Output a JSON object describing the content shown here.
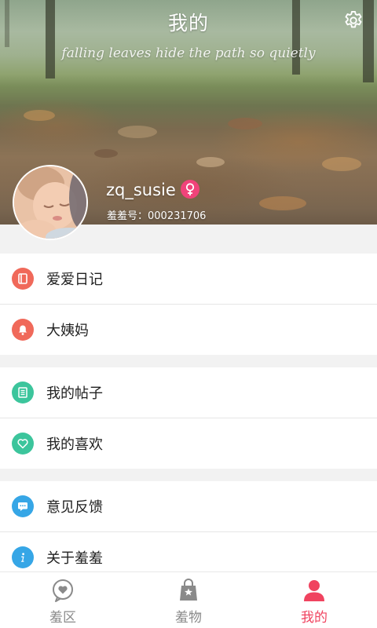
{
  "header": {
    "title": "我的",
    "subtitle": "falling leaves hide the path so quietly",
    "settings_icon": "gear-icon"
  },
  "profile": {
    "username": "zq_susie",
    "gender": "female",
    "user_id_text": "羞羞号：000231706"
  },
  "menu": {
    "groups": [
      {
        "items": [
          {
            "label": "爱爱日记",
            "icon": "notebook-icon",
            "color": "#f0695a"
          },
          {
            "label": "大姨妈",
            "icon": "bell-icon",
            "color": "#f0695a"
          }
        ]
      },
      {
        "items": [
          {
            "label": "我的帖子",
            "icon": "document-icon",
            "color": "#3cc59c"
          },
          {
            "label": "我的喜欢",
            "icon": "heart-icon",
            "color": "#3cc59c"
          }
        ]
      },
      {
        "items": [
          {
            "label": "意见反馈",
            "icon": "chat-bubble-icon",
            "color": "#36a6e6"
          },
          {
            "label": "关于羞羞",
            "icon": "info-icon",
            "color": "#36a6e6"
          }
        ]
      }
    ]
  },
  "bottom_nav": {
    "tabs": [
      {
        "label": "羞区",
        "icon": "heart-bubble-icon",
        "active": false
      },
      {
        "label": "羞物",
        "icon": "shopping-bag-icon",
        "active": false
      },
      {
        "label": "我的",
        "icon": "person-icon",
        "active": true
      }
    ],
    "active_color": "#f0435f",
    "inactive_color": "#8a8a8a"
  }
}
